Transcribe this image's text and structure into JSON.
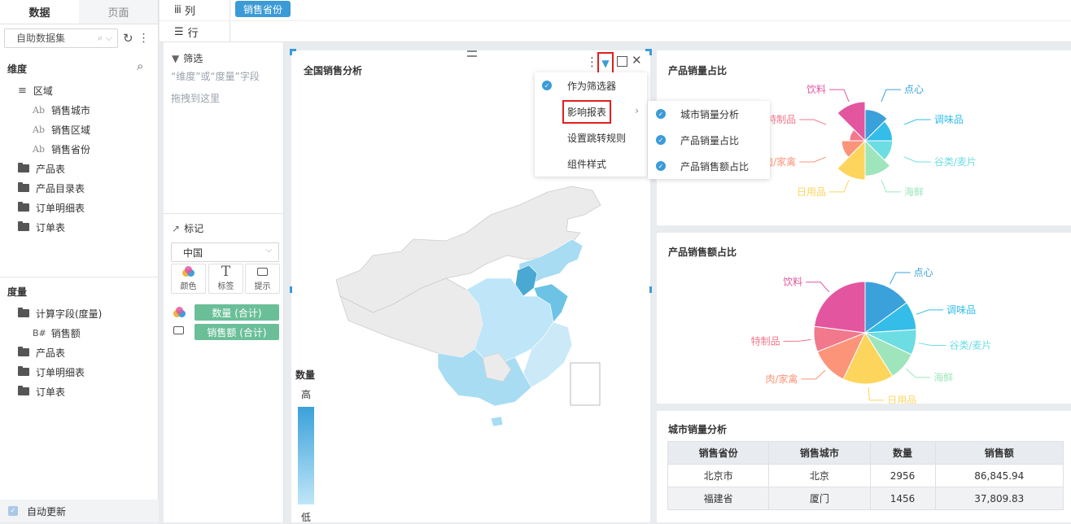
{
  "left_tabs": {
    "data": "数据",
    "page": "页面"
  },
  "datasource": "自助数据集",
  "dimension": {
    "title": "维度",
    "items": [
      {
        "label": "区域",
        "kind": "group"
      },
      {
        "label": "销售城市",
        "kind": "field"
      },
      {
        "label": "销售区域",
        "kind": "field"
      },
      {
        "label": "销售省份",
        "kind": "field"
      },
      {
        "label": "产品表",
        "kind": "folder"
      },
      {
        "label": "产品目录表",
        "kind": "folder"
      },
      {
        "label": "订单明细表",
        "kind": "folder"
      },
      {
        "label": "订单表",
        "kind": "folder"
      }
    ]
  },
  "measure": {
    "title": "度量",
    "items": [
      {
        "label": "计算字段(度量)",
        "kind": "openfolder"
      },
      {
        "label": "销售额",
        "kind": "num",
        "prefix": "B#"
      },
      {
        "label": "产品表",
        "kind": "folder"
      },
      {
        "label": "订单明细表",
        "kind": "folder"
      },
      {
        "label": "订单表",
        "kind": "folder"
      }
    ]
  },
  "auto_update": "自动更新",
  "toolbar": {
    "col_label": "列",
    "row_label": "行",
    "col_field": "销售省份",
    "col_icon": "iii"
  },
  "filter": {
    "title": "筛选",
    "hint1": "“维度”或“度量”字段",
    "hint2": "拖拽到这里"
  },
  "marks": {
    "title": "标记",
    "map_select": "中国",
    "btn_color": "颜色",
    "btn_label": "标签",
    "btn_tooltip": "提示",
    "field_color": "数量 (合计)",
    "field_tooltip": "销售额 (合计)",
    "btn_label_glyph": "T"
  },
  "map_card": {
    "title": "全国销售分析",
    "legend_title": "数量",
    "legend_high": "高",
    "legend_low": "低"
  },
  "context_menu": {
    "items": [
      "作为筛选器",
      "影响报表",
      "设置跳转规则",
      "组件样式"
    ]
  },
  "submenu": {
    "items": [
      "城市销量分析",
      "产品销量占比",
      "产品销售额占比"
    ]
  },
  "sales_ratio": {
    "title": "产品销量占比",
    "labels": [
      "点心",
      "调味品",
      "谷类/麦片",
      "海鲜",
      "日用品",
      "肉/家禽",
      "特制品",
      "饮料"
    ]
  },
  "amount_ratio": {
    "title": "产品销售额占比",
    "labels": [
      "点心",
      "调味品",
      "谷类/麦片",
      "海鲜",
      "日用品",
      "肉/家禽",
      "特制品",
      "饮料"
    ]
  },
  "city_table": {
    "title": "城市销量分析",
    "headers": [
      "销售省份",
      "销售城市",
      "数量",
      "销售额"
    ],
    "rows": [
      [
        "北京市",
        "北京",
        "2956",
        "86,845.94"
      ],
      [
        "福建省",
        "厦门",
        "1456",
        "37,809.83"
      ]
    ]
  },
  "colors": {
    "accent": "#3b9bd6",
    "field_green": "#6bbf98"
  },
  "pie_colors": [
    "#3ba1da",
    "#33bde8",
    "#6ddde4",
    "#9ee5bb",
    "#fdd55c",
    "#fb9479",
    "#f2788c",
    "#e4559f"
  ],
  "chart_data": [
    {
      "type": "pie",
      "variant": "rose",
      "title": "产品销量占比",
      "categories": [
        "点心",
        "调味品",
        "谷类/麦片",
        "海鲜",
        "日用品",
        "肉/家禽",
        "特制品",
        "饮料"
      ],
      "values": [
        0.8,
        0.7,
        0.7,
        0.9,
        1.0,
        0.6,
        0.4,
        1.0
      ]
    },
    {
      "type": "pie",
      "title": "产品销售额占比",
      "categories": [
        "点心",
        "调味品",
        "谷类/麦片",
        "海鲜",
        "日用品",
        "肉/家禽",
        "特制品",
        "饮料"
      ],
      "values": [
        15,
        9,
        8,
        9,
        16,
        12,
        8,
        23
      ]
    }
  ]
}
